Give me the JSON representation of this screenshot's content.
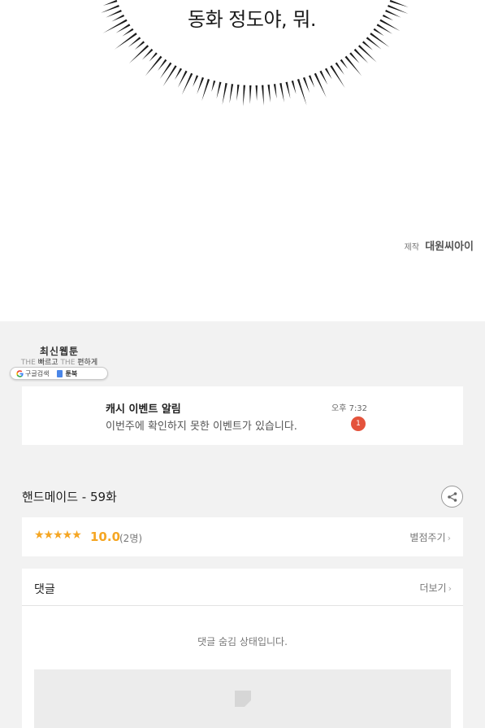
{
  "comic": {
    "speech_text": "동화 정도야, 뭐.",
    "credit_label": "제작",
    "credit_studio": "대원씨아이"
  },
  "banner": {
    "title": "최신웹툰",
    "tagline_prefix_1": "THE",
    "tagline_word_1": "빠르고",
    "tagline_prefix_2": "THE",
    "tagline_word_2": "편하게",
    "google_label": "구글검색",
    "site_label": "툰북"
  },
  "notice": {
    "title": "캐시 이벤트 알림",
    "text": "이번주에 확인하지 못한 이벤트가 있습니다.",
    "time": "오후 7:32",
    "badge_count": "1"
  },
  "episode": {
    "title": "핸드메이드 - 59화",
    "share_icon": "share-icon"
  },
  "rating": {
    "stars": "★★★★★",
    "star_value": 5,
    "score": "10.0",
    "votes": "(2명)",
    "rate_label": "별점주기",
    "accent_color": "#f5a623"
  },
  "comments": {
    "label": "댓글",
    "more_label": "더보기",
    "hidden_text": "댓글 숨김 상태입니다."
  },
  "colors": {
    "background_gray": "#f2f2f2",
    "badge_red": "#e4533c"
  }
}
